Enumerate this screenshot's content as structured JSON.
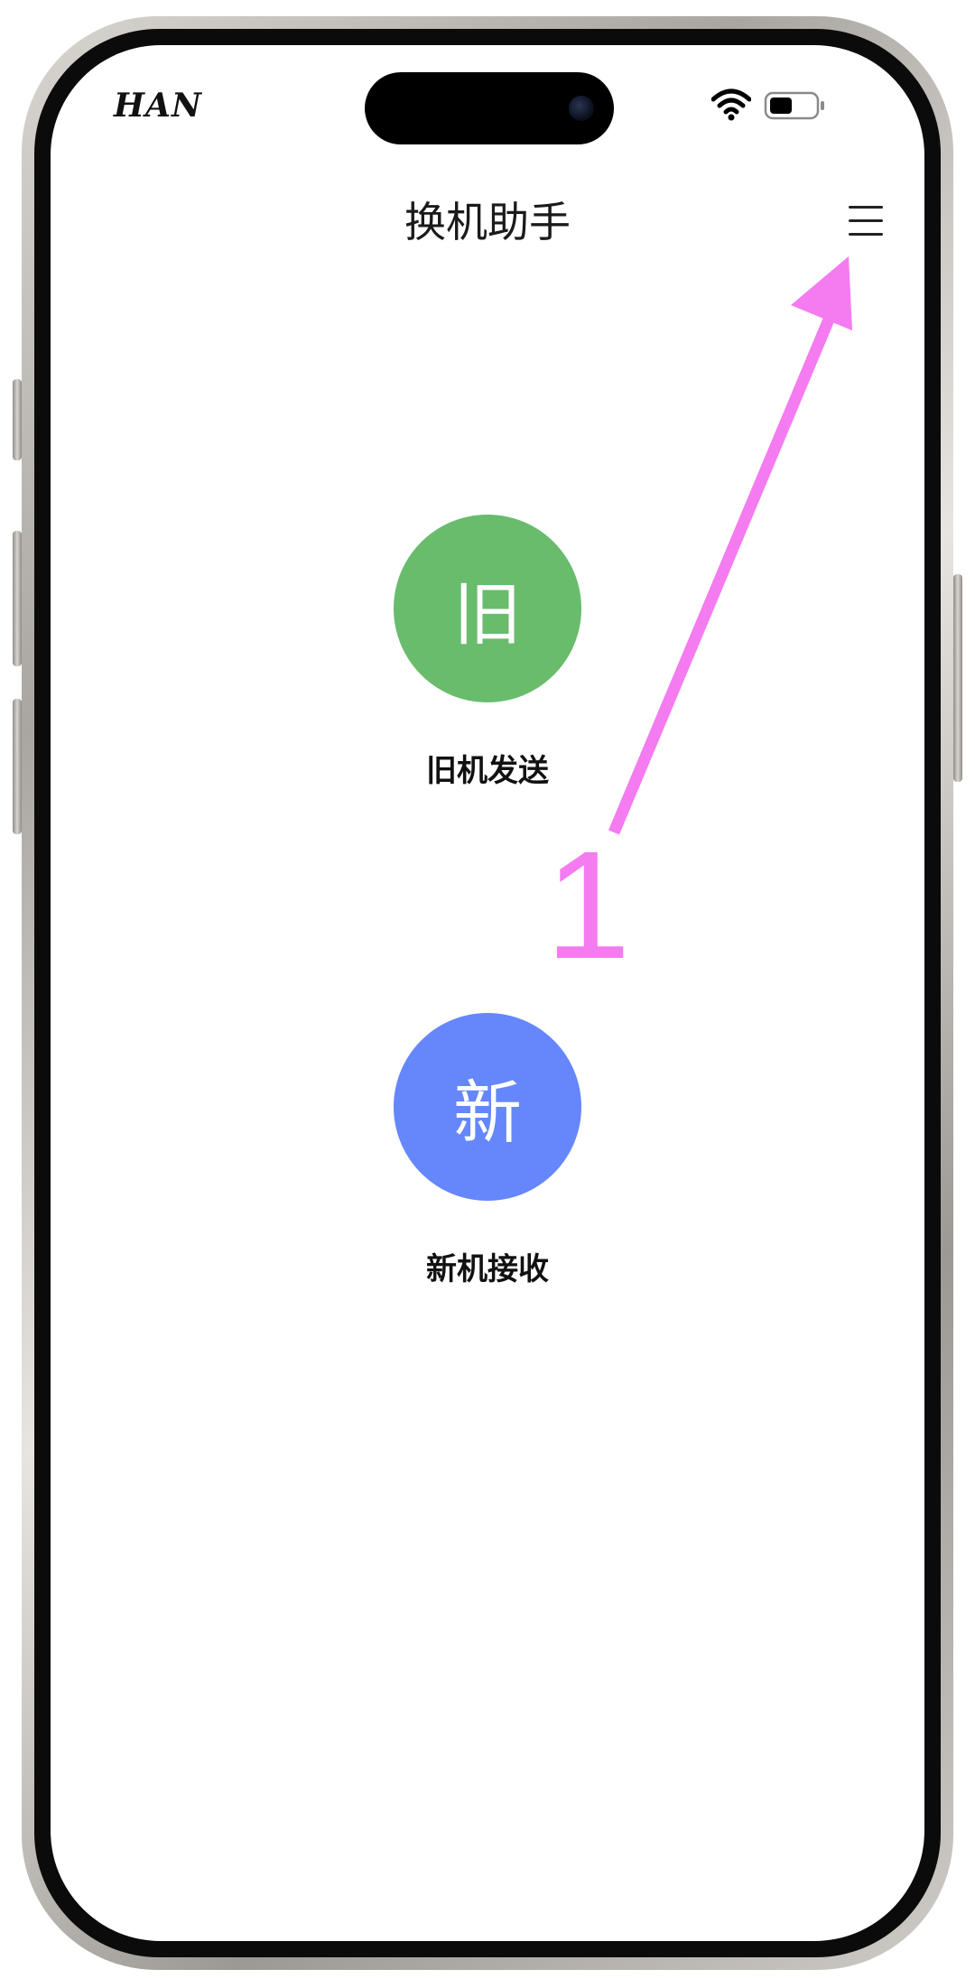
{
  "status_bar": {
    "carrier": "HAN",
    "wifi_icon": "wifi-icon",
    "battery_icon": "battery-icon"
  },
  "header": {
    "title": "换机助手",
    "menu_icon": "hamburger-menu-icon"
  },
  "actions": {
    "old_device": {
      "glyph": "旧",
      "label": "旧机发送",
      "color": "#68bc6c"
    },
    "new_device": {
      "glyph": "新",
      "label": "新机接收",
      "color": "#6587fb"
    }
  },
  "annotation": {
    "step_number": "1",
    "color": "#f47bf0"
  }
}
